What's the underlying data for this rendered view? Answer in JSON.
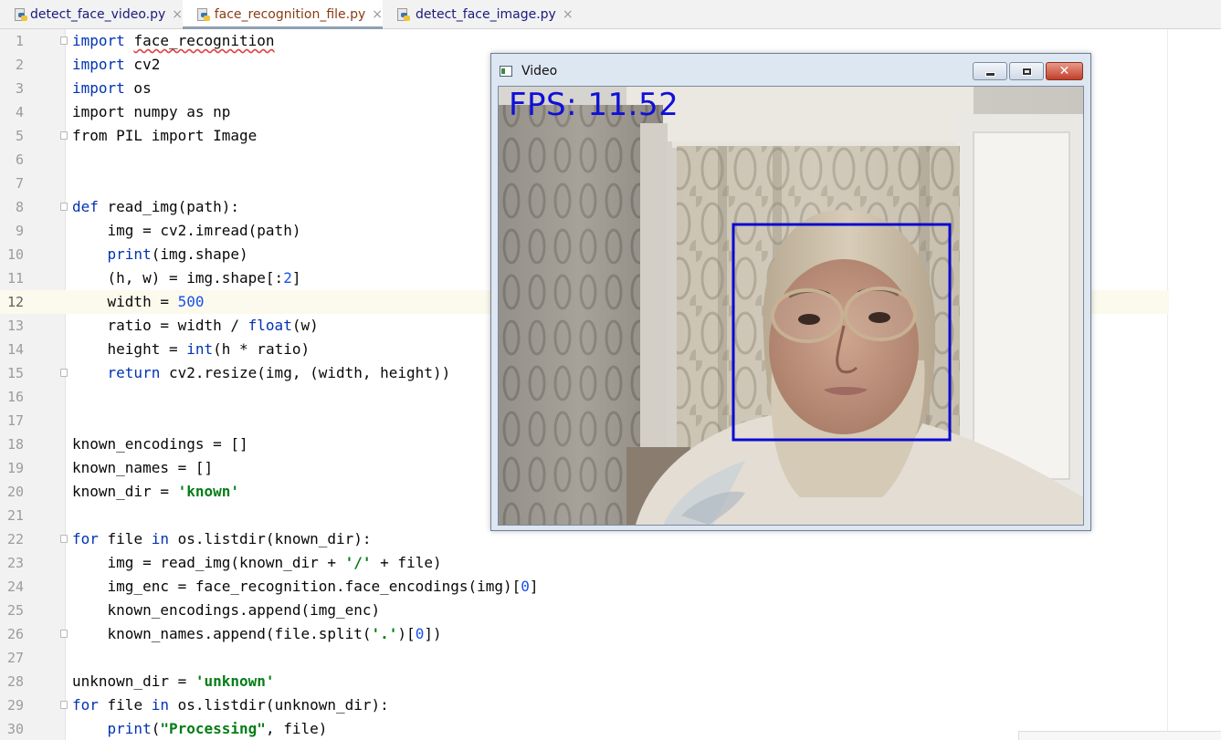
{
  "tabs": [
    {
      "label": "detect_face_video.py",
      "close": "×",
      "active": false
    },
    {
      "label": "face_recognition_file.py",
      "close": "×",
      "active": true
    },
    {
      "label": "detect_face_image.py",
      "close": "×",
      "active": false
    }
  ],
  "editor": {
    "current_line": 12,
    "lines": [
      {
        "n": "1"
      },
      {
        "n": "2"
      },
      {
        "n": "3"
      },
      {
        "n": "4"
      },
      {
        "n": "5"
      },
      {
        "n": "6"
      },
      {
        "n": "7"
      },
      {
        "n": "8"
      },
      {
        "n": "9"
      },
      {
        "n": "10"
      },
      {
        "n": "11"
      },
      {
        "n": "12"
      },
      {
        "n": "13"
      },
      {
        "n": "14"
      },
      {
        "n": "15"
      },
      {
        "n": "16"
      },
      {
        "n": "17"
      },
      {
        "n": "18"
      },
      {
        "n": "19"
      },
      {
        "n": "20"
      },
      {
        "n": "21"
      },
      {
        "n": "22"
      },
      {
        "n": "23"
      },
      {
        "n": "24"
      },
      {
        "n": "25"
      },
      {
        "n": "26"
      },
      {
        "n": "27"
      },
      {
        "n": "28"
      },
      {
        "n": "29"
      },
      {
        "n": "30"
      }
    ],
    "code": {
      "l1_kw": "import",
      "l1_rest": "face_recognition",
      "l2_kw": "import",
      "l2_rest": " cv2",
      "l3_kw": "import",
      "l3_rest": " os",
      "l4": "import numpy as np",
      "l5": "from PIL import Image",
      "l8_kw": "def",
      "l8_rest": " read_img(path):",
      "l9": "    img = cv2.imread(path)",
      "l10_bi": "print",
      "l10_rest": "(img.shape)",
      "l11_a": "    (h, w) = img.shape[:",
      "l11_num": "2",
      "l11_b": "]",
      "l12_a": "    width = ",
      "l12_num": "500",
      "l13_a": "    ratio = width / ",
      "l13_bi": "float",
      "l13_b": "(w)",
      "l14_a": "    height = ",
      "l14_bi": "int",
      "l14_b": "(h * ratio)",
      "l15_kw": "return",
      "l15_rest": " cv2.resize(img, (width, height))",
      "l18": "known_encodings = []",
      "l19": "known_names = []",
      "l20_a": "known_dir = ",
      "l20_str": "'known'",
      "l22_kw1": "for",
      "l22_mid": " file ",
      "l22_kw2": "in",
      "l22_rest": " os.listdir(known_dir):",
      "l23_a": "    img = read_img(known_dir + ",
      "l23_str": "'/'",
      "l23_b": " + file)",
      "l24_a": "    img_enc = face_recognition.face_encodings(img)[",
      "l24_num": "0",
      "l24_b": "]",
      "l25": "    known_encodings.append(img_enc)",
      "l26_a": "    known_names.append(file.split(",
      "l26_str": "'.'",
      "l26_b": ")[",
      "l26_num": "0",
      "l26_c": "])",
      "l28_a": "unknown_dir = ",
      "l28_str": "'unknown'",
      "l29_kw1": "for",
      "l29_mid": " file ",
      "l29_kw2": "in",
      "l29_rest": " os.listdir(unknown_dir):",
      "l30_bi": "print",
      "l30_a": "(",
      "l30_str": "\"Processing\"",
      "l30_b": ", file)"
    }
  },
  "video_window": {
    "title": "Video",
    "fps_text": "FPS: 11.52",
    "minimize": "minimize",
    "maximize": "maximize",
    "close_glyph": "✕",
    "face_box_color": "#0a0ad0"
  }
}
